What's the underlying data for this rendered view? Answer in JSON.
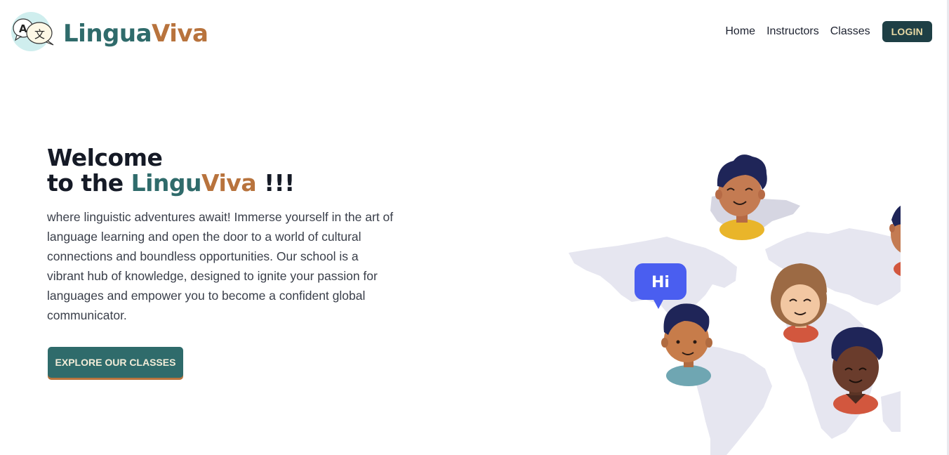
{
  "header": {
    "brand_part_1": "Lingua",
    "brand_part_2": "Viva",
    "nav": {
      "home": "Home",
      "instructors": "Instructors",
      "classes": "Classes",
      "login": "LOGIN"
    }
  },
  "hero": {
    "title_line_1": "Welcome",
    "title_prefix": "to the ",
    "title_accent_1": "Lingu",
    "title_accent_2": "Viva",
    "title_suffix": " !!!",
    "description": "where linguistic adventures await! Immerse yourself in the art of language learning and open the door to a world of cultural connections and boundless opportunities. Our school is a vibrant hub of knowledge, designed to ignite your passion for languages and empower you to become a confident global communicator.",
    "cta_label": "EXPLORE OUR CLASSES",
    "speech_bubble": "Hi"
  },
  "colors": {
    "brand_teal": "#2f6b6b",
    "brand_brown": "#b8733d",
    "login_bg": "#1e3f45",
    "login_text": "#e8d9a4",
    "speech_bubble": "#4a5ef0"
  },
  "icons": {
    "logo": "translate-bubble-icon"
  }
}
